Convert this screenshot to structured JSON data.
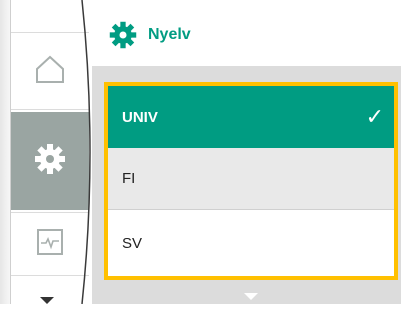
{
  "header": {
    "title": "Nyelv",
    "icon": "gear-icon",
    "accent_color": "#009c82"
  },
  "rail": {
    "items": [
      {
        "name": "home",
        "icon": "home-icon",
        "active": false
      },
      {
        "name": "settings",
        "icon": "gear-icon",
        "active": true
      },
      {
        "name": "diagnostics",
        "icon": "waveform-icon",
        "active": false
      }
    ]
  },
  "language_list": {
    "highlight_color": "#ffc000",
    "selected_color": "#009c82",
    "options": [
      {
        "label": "UNIV",
        "selected": true
      },
      {
        "label": "FI",
        "selected": false
      },
      {
        "label": "SV",
        "selected": false
      }
    ],
    "check_glyph": "✓"
  }
}
